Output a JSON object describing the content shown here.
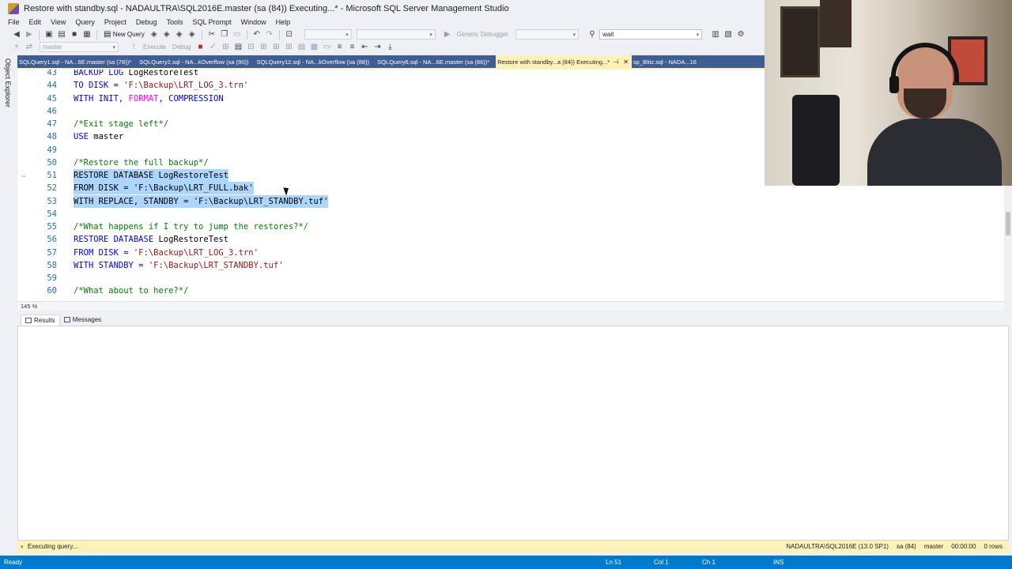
{
  "window": {
    "title": "Restore with standby.sql - NADAULTRA\\SQL2016E.master (sa (84)) Executing...* - Microsoft SQL Server Management Studio"
  },
  "menu": [
    "File",
    "Edit",
    "View",
    "Query",
    "Project",
    "Debug",
    "Tools",
    "SQL Prompt",
    "Window",
    "Help"
  ],
  "toolbar": {
    "new_query": "New Query",
    "generic_debugger": "Generic Debugger",
    "search_value": "wait",
    "database": "master",
    "execute": "Execute",
    "debug": "Debug"
  },
  "left_rail": {
    "label": "Object Explorer"
  },
  "doc_tabs": [
    {
      "label": "SQLQuery1.sql - NA...6E.master (sa (78))*"
    },
    {
      "label": "SQLQuery2.sql - NA...kOverflow (sa (90))"
    },
    {
      "label": "SQLQuery12.sql - NA...kOverflow (sa (88))"
    },
    {
      "label": "SQLQuery6.sql - NA...6E.master (sa (86))*"
    },
    {
      "label": "Restore with standby...a (84)) Executing...*"
    },
    {
      "label": "sp_Blitz.sql - NADA...16"
    }
  ],
  "editor": {
    "lines": [
      {
        "n": "43",
        "segs": [
          {
            "t": "BACKUP LOG",
            "c": "kw"
          },
          {
            "t": " LogRestoreTest",
            "c": ""
          }
        ]
      },
      {
        "n": "44",
        "segs": [
          {
            "t": "TO DISK = ",
            "c": "kw"
          },
          {
            "t": "'F:\\Backup\\LRT_LOG_3.trn'",
            "c": "str"
          }
        ]
      },
      {
        "n": "45",
        "segs": [
          {
            "t": "WITH INIT, ",
            "c": "kw"
          },
          {
            "t": "FORMAT",
            "c": "fn"
          },
          {
            "t": ", COMPRESSION",
            "c": "kw"
          }
        ]
      },
      {
        "n": "46",
        "segs": []
      },
      {
        "n": "47",
        "segs": [
          {
            "t": "/*Exit stage left*/",
            "c": "cm"
          }
        ]
      },
      {
        "n": "48",
        "segs": [
          {
            "t": "USE",
            "c": "kw"
          },
          {
            "t": " master",
            "c": ""
          }
        ]
      },
      {
        "n": "49",
        "segs": []
      },
      {
        "n": "50",
        "segs": [
          {
            "t": "/*Restore the full backup*/",
            "c": "cm"
          }
        ]
      },
      {
        "n": "51",
        "sel": true,
        "segs": [
          {
            "t": "RESTORE DATABASE LogRestoreTest",
            "c": ""
          }
        ]
      },
      {
        "n": "52",
        "sel": true,
        "segs": [
          {
            "t": "FROM DISK = 'F:\\Backup\\LRT_FULL.bak'",
            "c": ""
          }
        ]
      },
      {
        "n": "53",
        "sel": true,
        "segs": [
          {
            "t": "WITH REPLACE, STANDBY = 'F:\\Backup\\LRT_STANDBY.tuf'",
            "c": ""
          }
        ]
      },
      {
        "n": "54",
        "segs": []
      },
      {
        "n": "55",
        "segs": [
          {
            "t": "/*What happens if I try to jump the restores?*/",
            "c": "cm"
          }
        ]
      },
      {
        "n": "56",
        "segs": [
          {
            "t": "RESTORE DATABASE",
            "c": "kw"
          },
          {
            "t": " LogRestoreTest",
            "c": ""
          }
        ]
      },
      {
        "n": "57",
        "segs": [
          {
            "t": "FROM DISK = ",
            "c": "kw"
          },
          {
            "t": "'F:\\Backup\\LRT_LOG_3.trn'",
            "c": "str"
          }
        ]
      },
      {
        "n": "58",
        "segs": [
          {
            "t": "WITH STANDBY = ",
            "c": "kw"
          },
          {
            "t": "'F:\\Backup\\LRT_STANDBY.tuf'",
            "c": "str"
          }
        ]
      },
      {
        "n": "59",
        "segs": []
      },
      {
        "n": "60",
        "segs": [
          {
            "t": "/*What about to here?*/",
            "c": "cm"
          }
        ]
      }
    ],
    "zoom": "145 %"
  },
  "result_tabs": [
    {
      "label": "Results",
      "active": true
    },
    {
      "label": "Messages",
      "active": false
    }
  ],
  "query_status": {
    "message": "Executing query...",
    "server": "NADAULTRA\\SQL2016E (13.0 SP1)",
    "user": "sa (84)",
    "database": "master",
    "elapsed": "00:00:00",
    "rows": "0 rows"
  },
  "status_bar": {
    "ready": "Ready",
    "ln": "Ln 51",
    "col": "Col 1",
    "ch": "Ch 1",
    "mode": "INS"
  },
  "colors": {
    "status_bar": "#007acc",
    "doc_tabs": "#3e5d92",
    "active_tab": "#fff2b8",
    "selection": "#add6ff"
  }
}
